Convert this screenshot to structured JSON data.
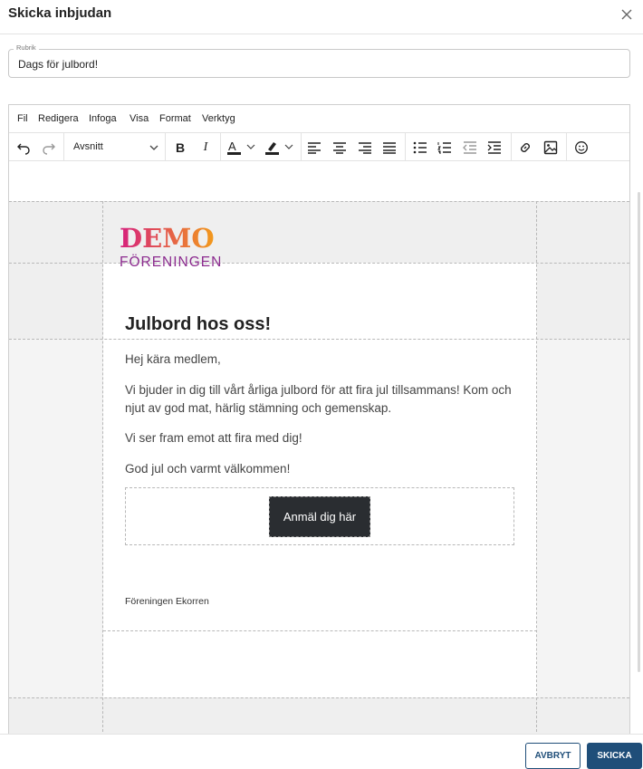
{
  "dialog": {
    "title": "Skicka inbjudan"
  },
  "subject": {
    "legend": "Rubrik",
    "value": "Dags för julbord!"
  },
  "menubar": [
    "Fil",
    "Redigera",
    "Infoga",
    "Visa",
    "Format",
    "Verktyg"
  ],
  "toolbar": {
    "block_format": "Avsnitt",
    "bold": "B",
    "italic": "I",
    "text_color_letter": "A",
    "text_color": "#222222",
    "highlight_color": "#222222"
  },
  "email": {
    "logo": {
      "word": "DEMO",
      "sub": "FÖRENINGEN",
      "color_start": "#d6207c",
      "color_end": "#f29a1c",
      "sub_color": "#8c2b8f"
    },
    "heading": "Julbord hos oss!",
    "paragraphs": [
      "Hej kära medlem,",
      "Vi bjuder in dig till vårt årliga julbord för att fira jul tillsammans! Kom och njut av god mat, härlig stämning och gemenskap.",
      "Vi ser fram emot att fira med dig!",
      "God jul och varmt välkommen!"
    ],
    "cta_label": "Anmäl dig här",
    "footer": "Föreningen Ekorren"
  },
  "actions": {
    "cancel": "AVBRYT",
    "send": "SKICKA"
  },
  "colors": {
    "primary": "#1f4e79",
    "button_dark": "#2a2d31",
    "canvas_gray": "#efefef"
  }
}
